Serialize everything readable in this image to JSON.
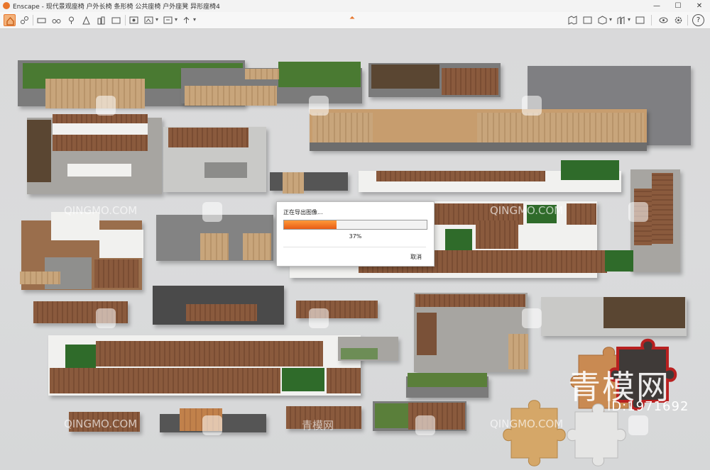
{
  "window": {
    "title": "Enscape - 现代景观座椅 户外长椅 条形椅 公共座椅 户外座凳 异形座椅4",
    "minimize": "—",
    "maximize": "☐",
    "close": "✕"
  },
  "toolbar": {
    "home_icon": "home-icon",
    "help_label": "?"
  },
  "export_dialog": {
    "message": "正在导出图像...",
    "progress": 0.37,
    "percent_label": "37%",
    "cancel_label": "取消"
  },
  "watermarks": {
    "site": "QINGMO.COM",
    "site_cn": "青模网",
    "logo_text": "青模网",
    "id_label": "ID:1971692"
  },
  "colors": {
    "accent": "#e8762b",
    "progress_fill": "#f07a2a"
  }
}
